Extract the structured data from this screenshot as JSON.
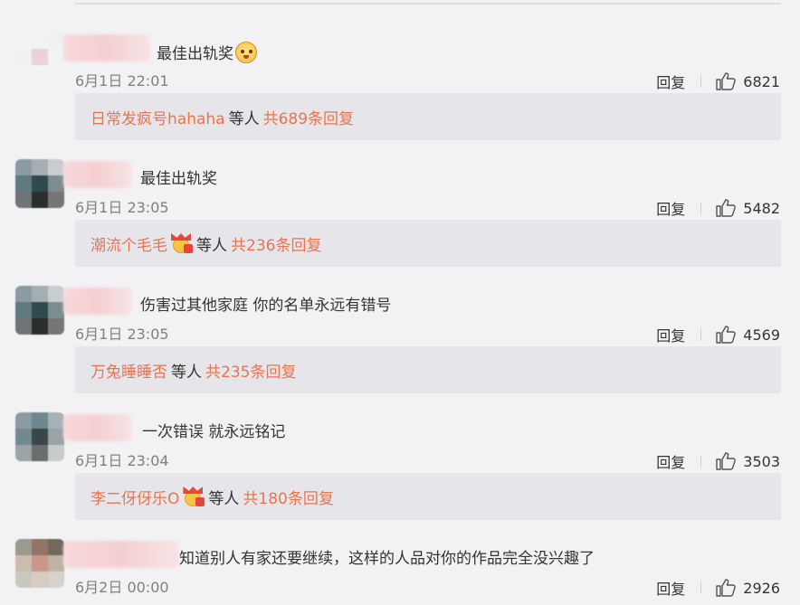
{
  "comments": [
    {
      "content": "最佳出轨奖",
      "has_emoji": true,
      "time": "6月1日 22:01",
      "reply_label": "回复",
      "likes": "6821",
      "replies": {
        "name": "日常发疯号hahaha",
        "has_badge": false,
        "etc": "等人",
        "total": "共689条回复"
      },
      "avatar_colors": [
        "#f2f2f5",
        "#f2f2f5",
        "#f0f0f2",
        "#f0f0f2",
        "#e9d3d6",
        "#f2f2f5",
        "#f2f2f5",
        "#f2f2f5",
        "#f2f2f5"
      ]
    },
    {
      "content": "最佳出轨奖",
      "has_emoji": false,
      "time": "6月1日 23:05",
      "reply_label": "回复",
      "likes": "5482",
      "replies": {
        "name": "潮流个毛毛",
        "has_badge": true,
        "etc": "等人",
        "total": "共236条回复"
      },
      "avatar_colors": [
        "#8c9aa3",
        "#a4aeb3",
        "#c9cdd0",
        "#5f7a80",
        "#2f4a4f",
        "#7d8c90",
        "#6f7477",
        "#2c2e2e",
        "#767676"
      ]
    },
    {
      "content": "伤害过其他家庭  你的名单永远有错号",
      "has_emoji": false,
      "time": "6月1日 23:05",
      "reply_label": "回复",
      "likes": "4569",
      "replies": {
        "name": "万兔睡睡否",
        "has_badge": false,
        "etc": "等人",
        "total": "共235条回复"
      },
      "avatar_colors": [
        "#8c9aa3",
        "#a4aeb3",
        "#c9cdd0",
        "#5f7a80",
        "#2f4a4f",
        "#7d8c90",
        "#6f7477",
        "#2c2e2e",
        "#767676"
      ]
    },
    {
      "content": "一次错误  就永远铭记",
      "has_emoji": false,
      "time": "6月1日 23:04",
      "reply_label": "回复",
      "likes": "3503",
      "replies": {
        "name": "李二伢伢乐O",
        "has_badge": true,
        "etc": "等人",
        "total": "共180条回复"
      },
      "avatar_colors": [
        "#8c9aa3",
        "#6d8790",
        "#a6b1b5",
        "#6f8a90",
        "#3a4648",
        "#9aa3a5",
        "#9ca4a6",
        "#6a6e6f",
        "#c8cbcc"
      ]
    },
    {
      "content": "知道别人有家还要继续，这样的人品对你的作品完全没兴趣了",
      "has_emoji": false,
      "time": "6月2日 00:00",
      "reply_label": "回复",
      "likes": "2926",
      "replies": null,
      "avatar_colors": [
        "#9a9a8f",
        "#8f7467",
        "#6f6a5c",
        "#cdbbb0",
        "#c9988a",
        "#bfb3a6",
        "#c9c7bf",
        "#d6ccc4",
        "#d7d2cb"
      ]
    }
  ],
  "colors": {
    "accent": "#eb7350",
    "background": "#f2f2f5",
    "reply_box": "#e6e6ea"
  }
}
